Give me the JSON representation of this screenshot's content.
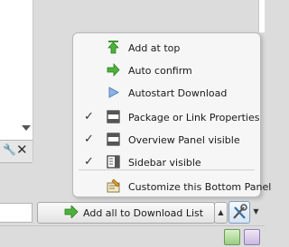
{
  "menu": {
    "items": [
      {
        "label": "Add at top",
        "checked": false,
        "icon": "green-up-arrow-icon"
      },
      {
        "label": "Auto confirm",
        "checked": false,
        "icon": "green-right-arrow-icon"
      },
      {
        "label": "Autostart Download",
        "checked": false,
        "icon": "blue-play-triangle-icon"
      },
      {
        "label": "Package or Link Properties",
        "checked": true,
        "icon": "panel-layout-icon"
      },
      {
        "label": "Overview Panel visible",
        "checked": true,
        "icon": "panel-layout-icon"
      },
      {
        "label": "Sidebar visible",
        "checked": true,
        "icon": "sidebar-layout-icon"
      },
      {
        "label": "Customize this Bottom Panel",
        "checked": false,
        "icon": "customize-icon"
      }
    ],
    "check_glyph": "✓"
  },
  "bottom_bar": {
    "add_all_label": "Add all to Download List",
    "spin_glyph": "▲",
    "dropdown_glyph": "▼"
  },
  "left_pane": {
    "close_glyph": "✕",
    "wrench_glyph": "🔧"
  },
  "colors": {
    "accent_green": "#3a9a2a",
    "accent_blue": "#4a7fc0"
  }
}
